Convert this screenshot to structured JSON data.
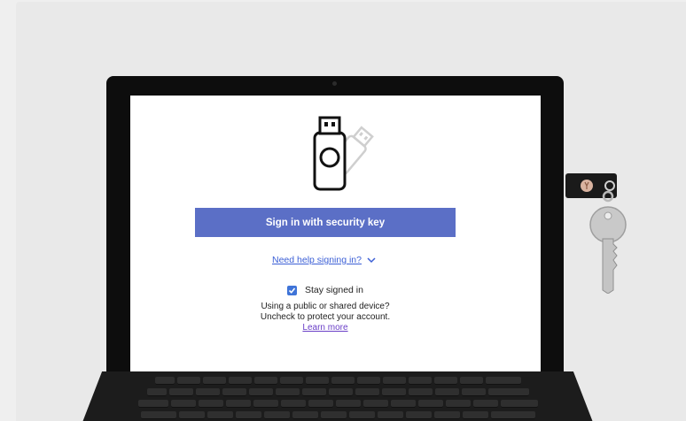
{
  "signin": {
    "button_label": "Sign in with security key",
    "help_link": "Need help signing in?",
    "stay_signed_in_label": "Stay signed in",
    "stay_signed_in_checked": true,
    "info_line1": "Using a public or shared device?",
    "info_line2": "Uncheck to protect your account.",
    "learn_more": "Learn more"
  },
  "colors": {
    "button": "#5b6fc6",
    "link": "#3b5fd6",
    "learn_more": "#6a3fc7",
    "checkbox": "#3f74d8"
  },
  "icons": {
    "hero": "usb-security-key-icon",
    "help": "chevron-down-icon",
    "checkbox": "checkmark-icon"
  }
}
